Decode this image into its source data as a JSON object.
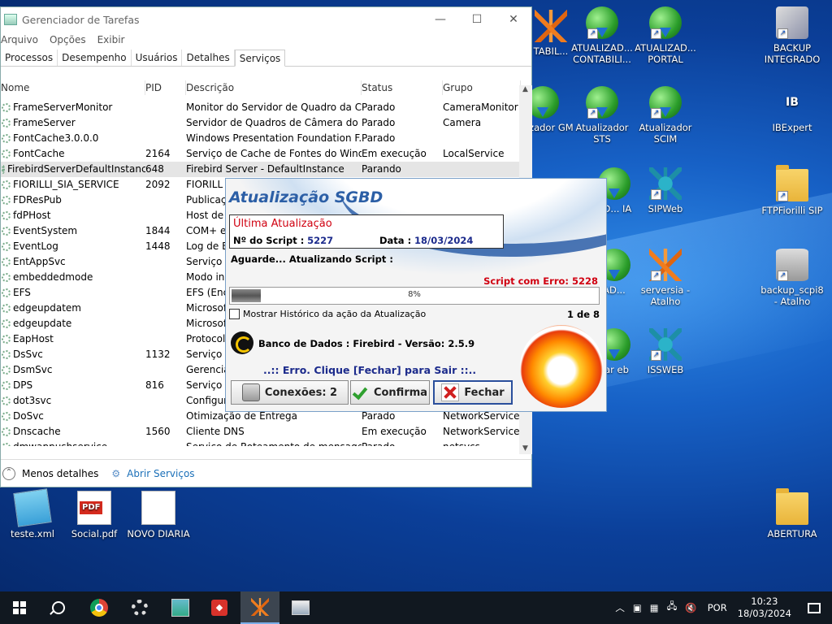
{
  "taskmanager": {
    "title": "Gerenciador de Tarefas",
    "menu": [
      "Arquivo",
      "Opções",
      "Exibir"
    ],
    "tabs": [
      "Processos",
      "Desempenho",
      "Usuários",
      "Detalhes",
      "Serviços"
    ],
    "active_tab": "Serviços",
    "columns": [
      "Nome",
      "PID",
      "Descrição",
      "Status",
      "Grupo"
    ],
    "rows": [
      {
        "name": "FrameServerMonitor",
        "pid": "",
        "desc": "Monitor do Servidor de Quadro da C...",
        "status": "Parado",
        "group": "CameraMonitor"
      },
      {
        "name": "FrameServer",
        "pid": "",
        "desc": "Servidor de Quadros de Câmera do ...",
        "status": "Parado",
        "group": "Camera"
      },
      {
        "name": "FontCache3.0.0.0",
        "pid": "",
        "desc": "Windows Presentation Foundation F...",
        "status": "Parado",
        "group": ""
      },
      {
        "name": "FontCache",
        "pid": "2164",
        "desc": "Serviço de Cache de Fontes do Wind...",
        "status": "Em execução",
        "group": "LocalService"
      },
      {
        "name": "FirebirdServerDefaultInstance",
        "pid": "648",
        "desc": "Firebird Server - DefaultInstance",
        "status": "Parando",
        "group": ""
      },
      {
        "name": "FIORILLI_SIA_SERVICE",
        "pid": "2092",
        "desc": "FIORILL",
        "status": "",
        "group": ""
      },
      {
        "name": "FDResPub",
        "pid": "",
        "desc": "Publicaç",
        "status": "",
        "group": ""
      },
      {
        "name": "fdPHost",
        "pid": "",
        "desc": "Host de I",
        "status": "",
        "group": ""
      },
      {
        "name": "EventSystem",
        "pid": "1844",
        "desc": "COM+ e",
        "status": "",
        "group": ""
      },
      {
        "name": "EventLog",
        "pid": "1448",
        "desc": "Log de E",
        "status": "",
        "group": ""
      },
      {
        "name": "EntAppSvc",
        "pid": "",
        "desc": "Serviço c",
        "status": "",
        "group": ""
      },
      {
        "name": "embeddedmode",
        "pid": "",
        "desc": "Modo in",
        "status": "",
        "group": ""
      },
      {
        "name": "EFS",
        "pid": "",
        "desc": "EFS (Enc",
        "status": "",
        "group": ""
      },
      {
        "name": "edgeupdatem",
        "pid": "",
        "desc": "Microsof",
        "status": "",
        "group": ""
      },
      {
        "name": "edgeupdate",
        "pid": "",
        "desc": "Microsof",
        "status": "",
        "group": ""
      },
      {
        "name": "EapHost",
        "pid": "",
        "desc": "Protocol",
        "status": "",
        "group": ""
      },
      {
        "name": "DsSvc",
        "pid": "1132",
        "desc": "Serviço c",
        "status": "",
        "group": ""
      },
      {
        "name": "DsmSvc",
        "pid": "",
        "desc": "Gerencia",
        "status": "",
        "group": ""
      },
      {
        "name": "DPS",
        "pid": "816",
        "desc": "Serviço c",
        "status": "",
        "group": ""
      },
      {
        "name": "dot3svc",
        "pid": "",
        "desc": "Configur",
        "status": "",
        "group": ""
      },
      {
        "name": "DoSvc",
        "pid": "",
        "desc": "Otimização de Entrega",
        "status": "Parado",
        "group": "NetworkService"
      },
      {
        "name": "Dnscache",
        "pid": "1560",
        "desc": "Cliente DNS",
        "status": "Em execução",
        "group": "NetworkService"
      },
      {
        "name": "dmwappushservice",
        "pid": "",
        "desc": "Serviço de Roteamento de mensage...",
        "status": "Parado",
        "group": "netsvcs"
      }
    ],
    "selected_row": 4,
    "footer_less": "Menos detalhes",
    "footer_open": "Abrir Serviços"
  },
  "dialog": {
    "title": "Atualização SGBD",
    "last_update": "Última Atualização",
    "script_label": "Nº do Script :",
    "script_value": "5227",
    "date_label": "Data :",
    "date_value": "18/03/2024",
    "waiting": "Aguarde...  Atualizando Script :",
    "error_script": "Script com Erro: 5228",
    "progress_percent": 8,
    "progress_text": "8%",
    "history_checkbox": "Mostrar Histórico da ação da Atualização",
    "counter": "1 de 8",
    "db_info": "Banco de Dados : Firebird - Versão: 2.5.9",
    "error_message": "..:: Erro. Clique [Fechar] para Sair ::..",
    "btn_connections": "Conexões: 2",
    "btn_confirm": "Confirma",
    "btn_close": "Fechar"
  },
  "desktop_icons": [
    {
      "label": "TABIL...",
      "icon": "orange-knot-icon"
    },
    {
      "label": "ATUALIZAD... CONTABILI...",
      "icon": "globe-download-icon"
    },
    {
      "label": "ATUALIZAD... PORTAL",
      "icon": "globe-download-icon"
    },
    {
      "label": "BACKUP INTEGRADO",
      "icon": "backup-tools-icon"
    },
    {
      "label": "ualizador GM",
      "icon": "globe-download-icon"
    },
    {
      "label": "Atualizador STS",
      "icon": "globe-download-icon"
    },
    {
      "label": "Atualizador SCIM",
      "icon": "globe-download-icon"
    },
    {
      "label": "IBExpert",
      "icon": "ibexpert-icon"
    },
    {
      "label": "AD... IA",
      "icon": "globe-download-icon"
    },
    {
      "label": "SIPWeb",
      "icon": "snowflake-icon"
    },
    {
      "label": "FTPFiorilli SIP",
      "icon": "folder-icon"
    },
    {
      "label": "AD...",
      "icon": "globe-download-icon"
    },
    {
      "label": "serversia - Atalho",
      "icon": "orange-knot-icon"
    },
    {
      "label": "backup_scpi8 - Atalho",
      "icon": "database-icon"
    },
    {
      "label": "zar eb",
      "icon": "globe-download-icon"
    },
    {
      "label": "ISSWEB",
      "icon": "snowflake-icon"
    },
    {
      "label": "teste.xml",
      "icon": "notepad-icon"
    },
    {
      "label": "Social.pdf",
      "icon": "pdf-icon"
    },
    {
      "label": "NOVO DIARIA",
      "icon": "blank-file-icon"
    },
    {
      "label": "ABERTURA",
      "icon": "folder-icon"
    }
  ],
  "pdf_badge": "PDF",
  "ibexpert_badge": "IB",
  "taskbar": {
    "language": "POR",
    "time": "10:23",
    "date": "18/03/2024"
  }
}
